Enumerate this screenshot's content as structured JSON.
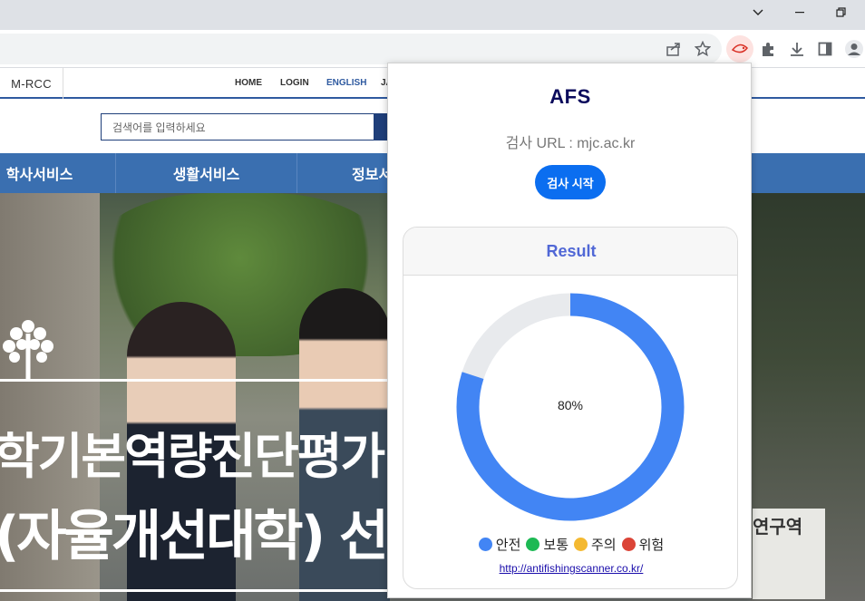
{
  "browser": {
    "window_controls": {
      "minimize": "–",
      "restore": "❐",
      "chevron": "⌄"
    },
    "toolbar_icons": [
      "share-icon",
      "star-icon",
      "extension-afs-icon",
      "puzzle-icon",
      "download-icon",
      "sidepanel-icon",
      "profile-icon"
    ]
  },
  "site": {
    "brand": "M-RCC",
    "topnav": [
      "HOME",
      "LOGIN",
      "ENGLISH",
      "JA"
    ],
    "search_placeholder": "검색어를 입력하세요",
    "mainnav": [
      "학사서비스",
      "생활서비스",
      "정보서"
    ],
    "hero_line1": "학기본역량진단평가",
    "hero_line2": "(자율개선대학) 선",
    "sign_text": "연구역"
  },
  "popup": {
    "title": "AFS",
    "url_label": "검사 URL : mjc.ac.kr",
    "start_button": "검사 시작",
    "result_title": "Result",
    "percent_label": "80%",
    "legend": [
      {
        "label": "안전",
        "color": "#4285f4"
      },
      {
        "label": "보통",
        "color": "#1db954"
      },
      {
        "label": "주의",
        "color": "#f4b931"
      },
      {
        "label": "위험",
        "color": "#db4437"
      }
    ],
    "link": "http://antifishingscanner.co.kr/"
  },
  "chart_data": {
    "type": "pie",
    "categories": [
      "안전",
      "remaining"
    ],
    "values": [
      80,
      20
    ],
    "colors": [
      "#4285f4",
      "#e8eaed"
    ],
    "center_label": "80%"
  }
}
